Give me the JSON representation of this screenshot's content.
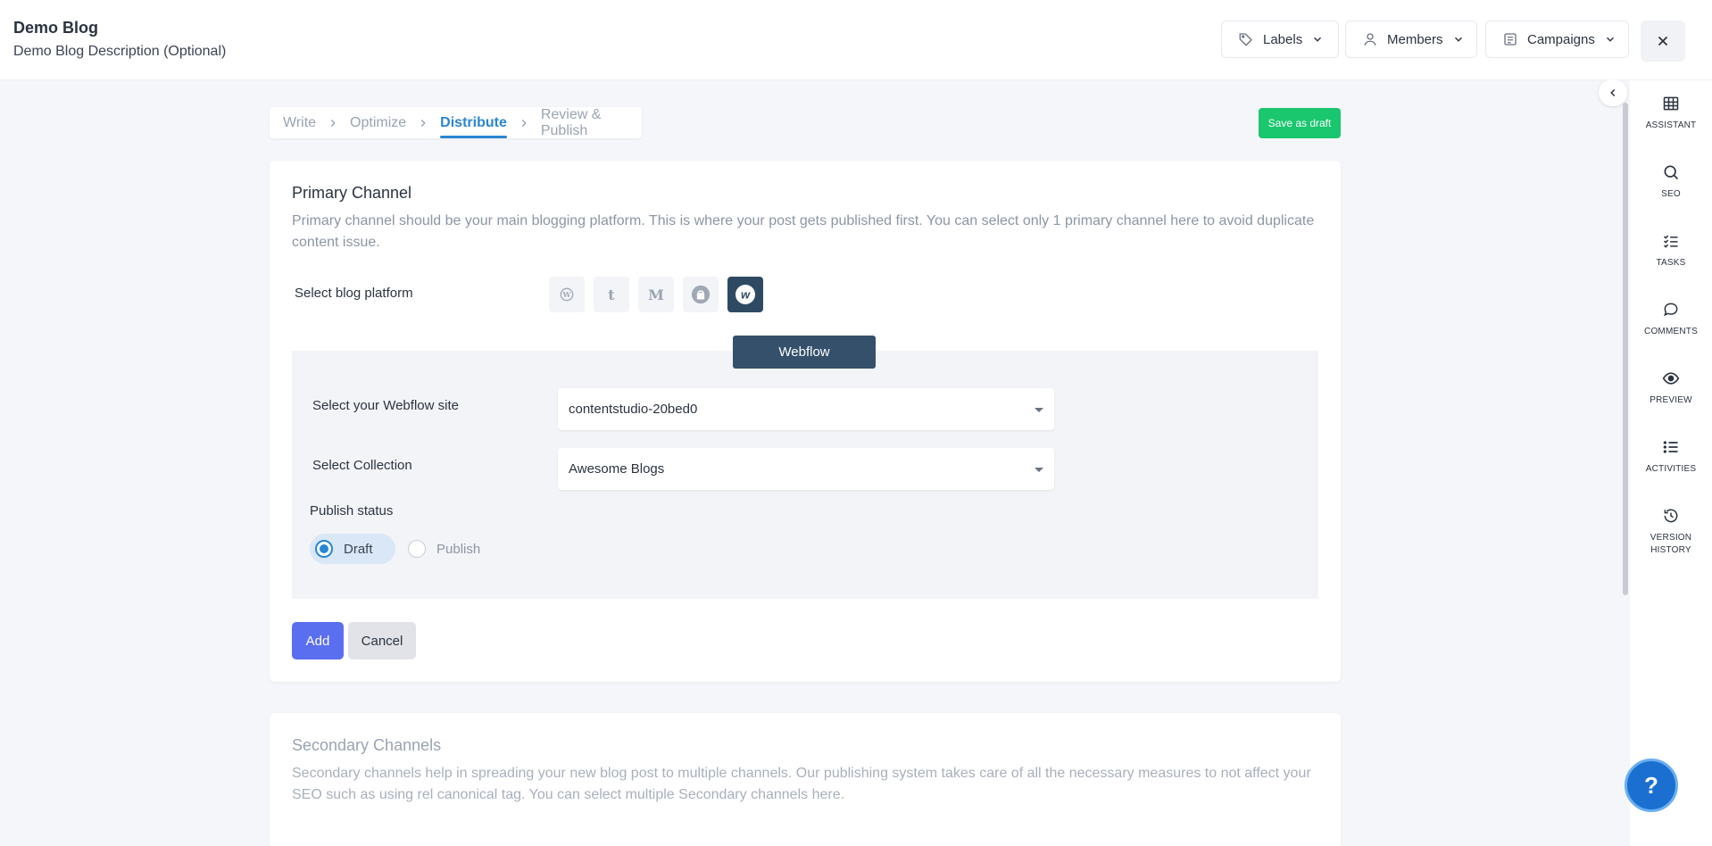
{
  "header": {
    "title": "Demo Blog",
    "description": "Demo Blog Description (Optional)",
    "labels_button": "Labels",
    "members_button": "Members",
    "campaigns_button": "Campaigns"
  },
  "stepper": {
    "steps": [
      "Write",
      "Optimize",
      "Distribute",
      "Review & Publish"
    ],
    "active": "Distribute"
  },
  "save_draft_label": "Save as draft",
  "primary": {
    "title": "Primary Channel",
    "description": "Primary channel should be your main blogging platform. This is where your post gets published first. You can select only 1 primary channel here to avoid duplicate content issue.",
    "platform_label": "Select blog platform",
    "platforms": [
      {
        "name": "wordpress-icon",
        "glyph": "W"
      },
      {
        "name": "tumblr-icon",
        "glyph": "t"
      },
      {
        "name": "medium-icon",
        "glyph": "M"
      },
      {
        "name": "shopify-icon",
        "glyph": ""
      },
      {
        "name": "webflow-icon",
        "glyph": "w",
        "active": true
      }
    ],
    "selected_platform": "Webflow",
    "site_label": "Select your Webflow site",
    "site_value": "contentstudio-20bed0",
    "collection_label": "Select Collection",
    "collection_value": "Awesome Blogs",
    "publish_status_label": "Publish status",
    "status_options": [
      "Draft",
      "Publish"
    ],
    "status_selected": "Draft",
    "add_label": "Add",
    "cancel_label": "Cancel"
  },
  "secondary": {
    "title": "Secondary Channels",
    "description": "Secondary channels help in spreading your new blog post to multiple channels. Our publishing system takes care of all the necessary measures to not affect your SEO such as using rel canonical tag. You can select multiple Secondary channels here."
  },
  "sidebar": {
    "items": [
      {
        "icon": "grid-icon",
        "label": "ASSISTANT"
      },
      {
        "icon": "search-icon",
        "label": "SEO"
      },
      {
        "icon": "checklist-icon",
        "label": "TASKS"
      },
      {
        "icon": "comment-icon",
        "label": "COMMENTS"
      },
      {
        "icon": "eye-icon",
        "label": "PREVIEW"
      },
      {
        "icon": "list-icon",
        "label": "ACTIVITIES"
      },
      {
        "icon": "history-icon",
        "label": "VERSION HISTORY"
      }
    ]
  },
  "help_label": "?",
  "colors": {
    "accent": "#2a86d2",
    "save_green": "#1ac66e",
    "add_blue": "#5a6ef0",
    "webflow_dark": "#34506b"
  }
}
